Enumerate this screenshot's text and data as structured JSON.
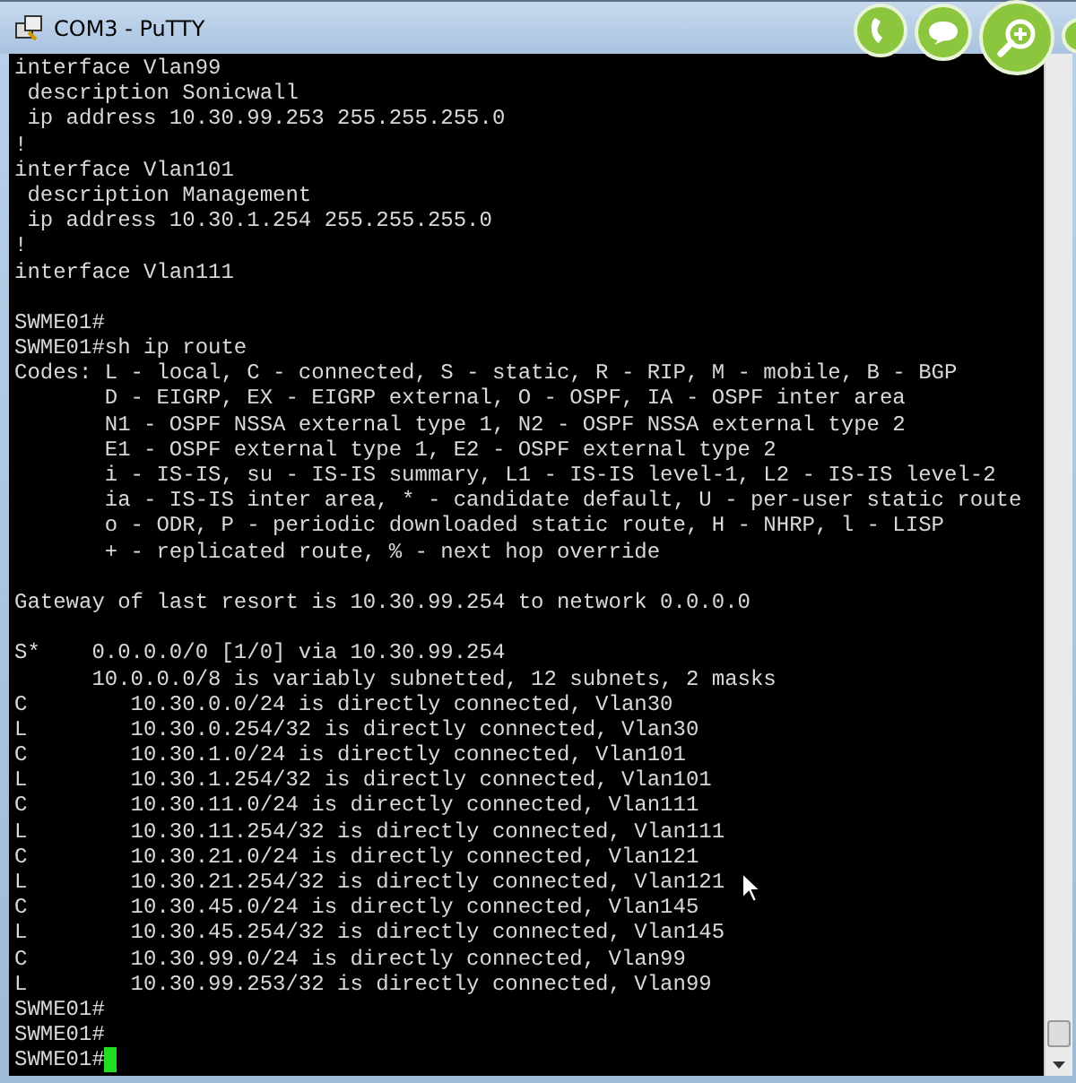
{
  "window": {
    "title": "COM3 - PuTTY"
  },
  "terminal": {
    "cursor_visible": true,
    "blocks": [
      [
        "interface Vlan99",
        " description Sonicwall",
        " ip address 10.30.99.253 255.255.255.0",
        "!",
        "interface Vlan101",
        " description Management",
        " ip address 10.30.1.254 255.255.255.0",
        "!",
        "interface Vlan111"
      ],
      [
        "SWME01#",
        "SWME01#sh ip route",
        "Codes: L - local, C - connected, S - static, R - RIP, M - mobile, B - BGP",
        "       D - EIGRP, EX - EIGRP external, O - OSPF, IA - OSPF inter area",
        "       N1 - OSPF NSSA external type 1, N2 - OSPF NSSA external type 2",
        "       E1 - OSPF external type 1, E2 - OSPF external type 2",
        "       i - IS-IS, su - IS-IS summary, L1 - IS-IS level-1, L2 - IS-IS level-2",
        "       ia - IS-IS inter area, * - candidate default, U - per-user static route",
        "       o - ODR, P - periodic downloaded static route, H - NHRP, l - LISP",
        "       + - replicated route, % - next hop override"
      ],
      [
        "Gateway of last resort is 10.30.99.254 to network 0.0.0.0"
      ],
      [
        "S*    0.0.0.0/0 [1/0] via 10.30.99.254",
        "      10.0.0.0/8 is variably subnetted, 12 subnets, 2 masks",
        "C        10.30.0.0/24 is directly connected, Vlan30",
        "L        10.30.0.254/32 is directly connected, Vlan30",
        "C        10.30.1.0/24 is directly connected, Vlan101",
        "L        10.30.1.254/32 is directly connected, Vlan101",
        "C        10.30.11.0/24 is directly connected, Vlan111",
        "L        10.30.11.254/32 is directly connected, Vlan111",
        "C        10.30.21.0/24 is directly connected, Vlan121",
        "L        10.30.21.254/32 is directly connected, Vlan121",
        "C        10.30.45.0/24 is directly connected, Vlan145",
        "L        10.30.45.254/32 is directly connected, Vlan145",
        "C        10.30.99.0/24 is directly connected, Vlan99",
        "L        10.30.99.253/32 is directly connected, Vlan99",
        "SWME01#",
        "SWME01#",
        "SWME01#"
      ]
    ]
  }
}
